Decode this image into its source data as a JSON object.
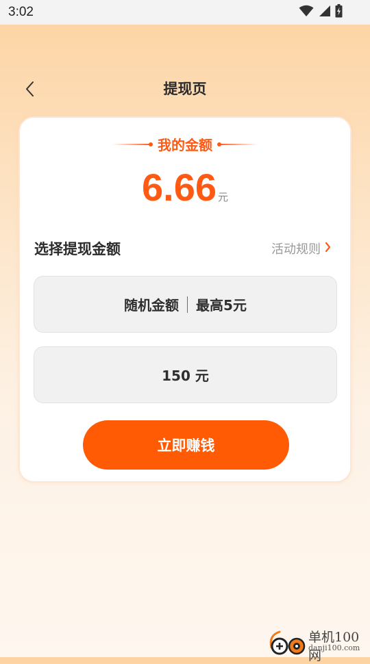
{
  "status_bar": {
    "time": "3:02",
    "icons": [
      "wifi-icon",
      "signal-icon",
      "battery-icon"
    ]
  },
  "header": {
    "back_icon": "chevron-left-icon",
    "title": "提现页"
  },
  "card": {
    "amount_heading": "我的金额",
    "amount_value": "6.66",
    "amount_unit": "元",
    "section_title": "选择提现金额",
    "rules_link": "活动规则",
    "rules_icon": "chevron-right-icon",
    "options": [
      {
        "left": "随机金额",
        "right": "最高5元"
      },
      {
        "label": "150 元"
      }
    ],
    "earn_button": "立即赚钱"
  },
  "watermark": {
    "title": "单机100网",
    "url": "danji100.com"
  },
  "colors": {
    "accent": "#ff5a04",
    "amount": "#ff5a14",
    "bg_top": "#fdd3a2",
    "bg_bottom": "#fef7ef"
  }
}
